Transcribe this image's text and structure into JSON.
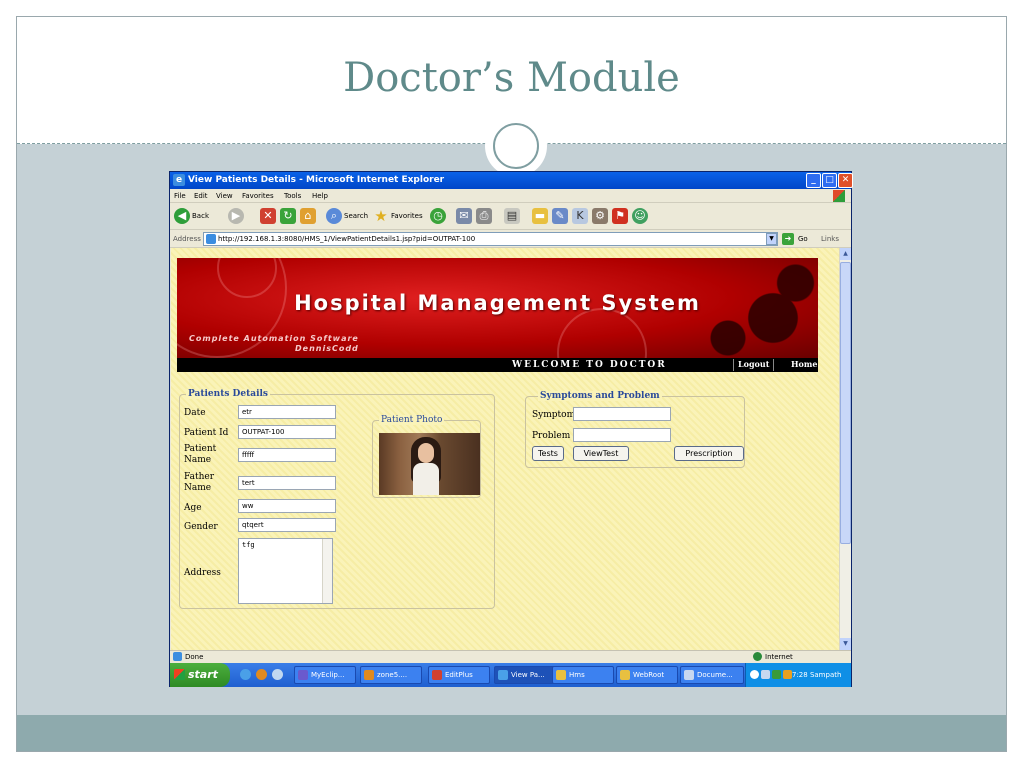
{
  "slide": {
    "title": "Doctor’s Module"
  },
  "window": {
    "title": "View Patients Details - Microsoft Internet Explorer",
    "controls": {
      "minimize": "_",
      "maximize": "□",
      "close": "✕"
    }
  },
  "menubar": {
    "items": [
      "File",
      "Edit",
      "View",
      "Favorites",
      "Tools",
      "Help"
    ]
  },
  "toolbar": {
    "back": "Back",
    "search": "Search",
    "favorites": "Favorites"
  },
  "addressbar": {
    "label": "Address",
    "url": "http://192.168.1.3:8080/HMS_1/ViewPatientDetails1.jsp?pid=OUTPAT-100",
    "go": "Go",
    "links": "Links"
  },
  "banner": {
    "title": "Hospital Management System",
    "subtitle": "Complete Automation Software",
    "author": "DennisCodd"
  },
  "nav": {
    "welcome": "WELCOME TO DOCTOR",
    "logout": "Logout",
    "home": "Home"
  },
  "patient": {
    "legend": "Patients Details",
    "date_label": "Date",
    "date": "etr",
    "id_label": "Patient Id",
    "id": "OUTPAT-100",
    "name_label_1": "Patient",
    "name_label_2": "Name",
    "name": "fffff",
    "father_label_1": "Father",
    "father_label_2": "Name",
    "father": "tert",
    "age_label": "Age",
    "age": "ww",
    "gender_label": "Gender",
    "gender": "qtqert",
    "address_label": "Address",
    "address": "tfg",
    "photo_legend": "Patient Photo"
  },
  "symptoms": {
    "legend": "Symptoms and Problem",
    "symptom_label": "Symptom",
    "symptom": "",
    "problem_label": "Problem",
    "problem": "",
    "tests": "Tests",
    "view_test": "ViewTest",
    "prescription": "Prescription"
  },
  "statusbar": {
    "text": "Done",
    "zone": "Internet"
  },
  "taskbar": {
    "start": "start",
    "tasks": [
      "MyEclip...",
      "zone5....",
      "EditPlus",
      "View Pa...",
      "Hms",
      "WebRoot",
      "Docume..."
    ],
    "clock": "7:28 Sampath"
  },
  "colors": {
    "title": "#5f8a8a",
    "legend": "#2a4a9a",
    "banner": "#c00000",
    "page_bg": "#faf3b8"
  }
}
